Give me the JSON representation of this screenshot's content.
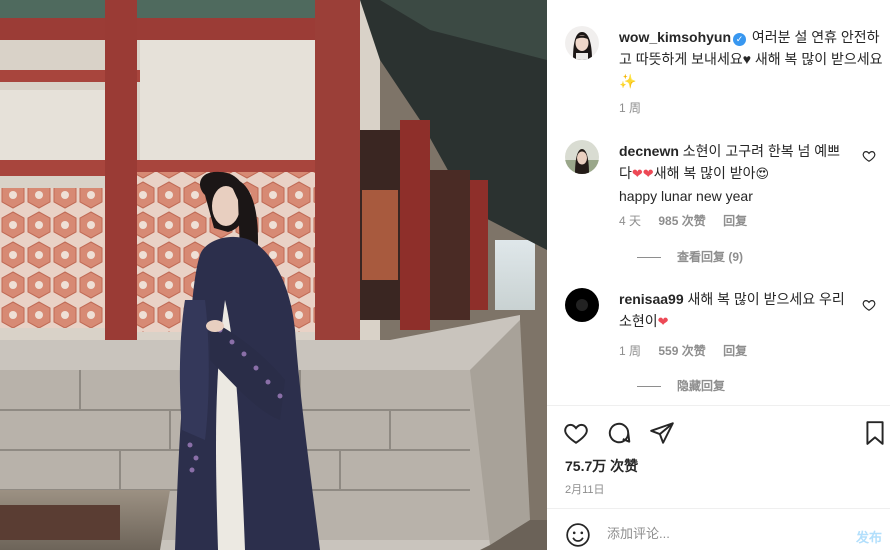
{
  "post": {
    "username": "wow_kimsohyun",
    "caption": " 여러분 설 연휴 안전하고 따뜻하게 보내세요♥ 새해 복 많이 받으세요✨",
    "time": "1 周"
  },
  "comments": [
    {
      "username": "decnewn",
      "text_before": " 소현이 고구려 한복 넘 예쁘다",
      "text_after": "새해 복 많이 받아",
      "text_line2": "happy lunar new year",
      "time": "4 天",
      "likes": "985 次赞",
      "reply": "回复",
      "view_replies": "查看回复 (9)"
    },
    {
      "username": "renisaa99",
      "text_before": " 새해 복 많이 받으세요 우리 소현이",
      "time": "1 周",
      "likes": "559 次赞",
      "reply": "回复",
      "view_replies": "隐藏回复"
    }
  ],
  "likes_count": "75.7万 次赞",
  "date": "2月11日",
  "add_comment": {
    "placeholder": "添加评论...",
    "post_label": "发布"
  },
  "icons": {
    "like": "heart-icon",
    "comment": "comment-icon",
    "share": "share-icon",
    "save": "bookmark-icon",
    "emoji": "smiley-icon"
  },
  "colors": {
    "verified": "#3897f0",
    "heart_emoji": "#ed4956",
    "post_button": "#b2dffc",
    "muted_text": "#8e8e8e"
  }
}
